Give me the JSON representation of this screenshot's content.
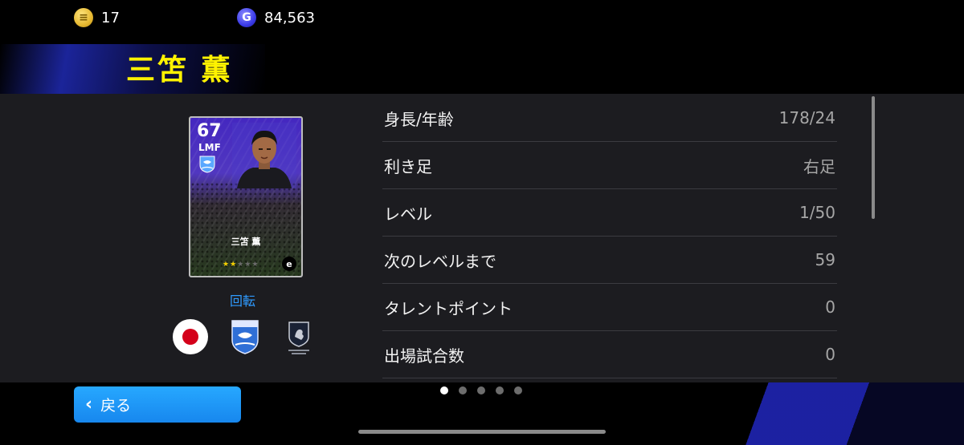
{
  "header": {
    "coins": {
      "icon": "coin-icon",
      "value": "17"
    },
    "gp": {
      "icon": "gp-icon",
      "icon_letter": "G",
      "value": "84,563"
    },
    "player_name": "三笘 薫"
  },
  "card": {
    "rating": "67",
    "position": "LMF",
    "name": "三笘 薫",
    "stars_filled": 2,
    "stars_total": 5,
    "brand_letter": "e"
  },
  "rotate_label": "回転",
  "badges": {
    "nation": "japan-flag-icon",
    "club": "club-crest-icon",
    "league": "league-crest-icon"
  },
  "stats": [
    {
      "label": "身長/年齢",
      "value": "178/24"
    },
    {
      "label": "利き足",
      "value": "右足"
    },
    {
      "label": "レベル",
      "value": "1/50"
    },
    {
      "label": "次のレベルまで",
      "value": "59"
    },
    {
      "label": "タレントポイント",
      "value": "0"
    },
    {
      "label": "出場試合数",
      "value": "0"
    }
  ],
  "footer": {
    "back_label": "戻る",
    "pager_count": 5,
    "pager_active": 0
  },
  "colors": {
    "title_yellow": "#fff200",
    "accent_blue": "#1f95f5",
    "panel_bg": "#1c1c20"
  }
}
